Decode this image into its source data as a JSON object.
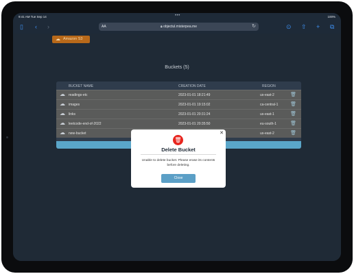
{
  "status": {
    "time": "9:41 AM",
    "date": "Tue Sep 14",
    "right": "100%"
  },
  "toolbar": {
    "aa": "AA",
    "url": "objectul.misterpea.me"
  },
  "app": {
    "badge": "Amazon S3",
    "title": "Buckets (5)"
  },
  "table": {
    "headers": [
      "BUCKET NAME",
      "CREATION DATE",
      "REGION"
    ],
    "rows": [
      {
        "name": "readings-etc",
        "date": "2023-01-01 18:21:49",
        "region": "us-east-2"
      },
      {
        "name": "images",
        "date": "2023-01-01 19:15:02",
        "region": "ca-central-1"
      },
      {
        "name": "links",
        "date": "2023-01-01 20:31:24",
        "region": "us-east-1"
      },
      {
        "name": "leetcode-end-of-2022",
        "date": "2023-01-01 20:35:50",
        "region": "eu-south-1"
      },
      {
        "name": "new-bucket",
        "date": "",
        "region": "us-east-2"
      }
    ]
  },
  "modal": {
    "title": "Delete Bucket",
    "message": "Unable to delete bucket. Please erase its contents before deleting.",
    "button": "Close"
  },
  "icons": {
    "sidebar": "sidebar-icon",
    "back": "chevron-left-icon",
    "forward": "chevron-right-icon",
    "lock": "lock-icon",
    "reload": "reload-icon",
    "share": "share-icon",
    "download": "download-icon",
    "new_tab": "plus-icon",
    "tabs": "tabs-icon",
    "cloud": "cloud-icon",
    "trash": "trash-icon",
    "close": "close-icon"
  },
  "colors": {
    "badge": "#b8691a",
    "modal_button": "#5b9fc6",
    "trash_red": "#e8261f"
  }
}
